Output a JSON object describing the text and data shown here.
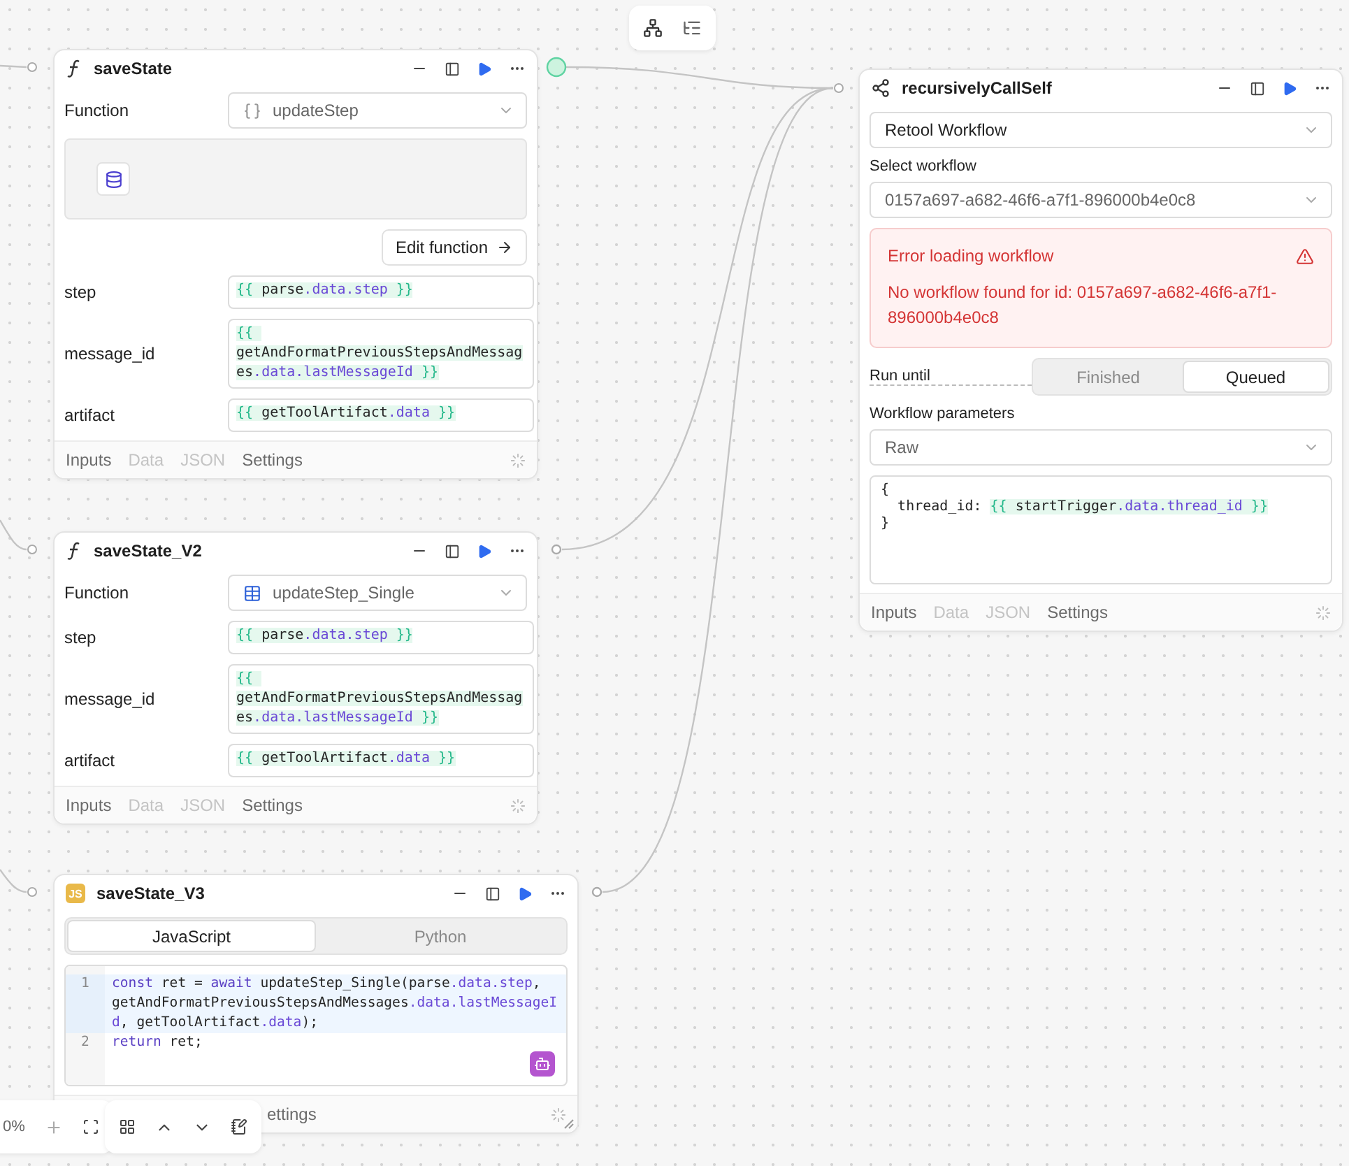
{
  "zoom": "0%",
  "nodes": [
    {
      "kind": "function",
      "title": "saveState",
      "output_active": true,
      "show_preview": true,
      "function_field": {
        "label": "Function",
        "value": "updateStep",
        "kind": "code"
      },
      "edit_button": "Edit function",
      "params": [
        {
          "name": "step",
          "tokens": [
            {
              "text": "{{ ",
              "kind": "brace"
            },
            {
              "text": "parse",
              "kind": "ident"
            },
            {
              "text": ".data.step",
              "kind": "prop"
            },
            {
              "text": " }}",
              "kind": "brace"
            }
          ]
        },
        {
          "name": "message_id",
          "tokens": [
            {
              "text": "{{ ",
              "kind": "brace"
            },
            {
              "text": "getAndFormatPreviousStepsAndMessages",
              "kind": "ident"
            },
            {
              "text": ".data.lastMessageId",
              "kind": "prop"
            },
            {
              "text": " }}",
              "kind": "brace"
            }
          ]
        },
        {
          "name": "artifact",
          "tokens": [
            {
              "text": "{{ ",
              "kind": "brace"
            },
            {
              "text": "getToolArtifact",
              "kind": "ident"
            },
            {
              "text": ".data",
              "kind": "prop"
            },
            {
              "text": " }}",
              "kind": "brace"
            }
          ]
        }
      ],
      "footer_tabs": [
        {
          "label": "Inputs",
          "disabled": false
        },
        {
          "label": "Data",
          "disabled": true
        },
        {
          "label": "JSON",
          "disabled": true
        },
        {
          "label": "Settings",
          "disabled": false
        }
      ]
    },
    {
      "kind": "function",
      "title": "saveState_V2",
      "output_active": false,
      "show_preview": false,
      "function_field": {
        "label": "Function",
        "value": "updateStep_Single",
        "kind": "table"
      },
      "params": [
        {
          "name": "step",
          "tokens": [
            {
              "text": "{{ ",
              "kind": "brace"
            },
            {
              "text": "parse",
              "kind": "ident"
            },
            {
              "text": ".data.step",
              "kind": "prop"
            },
            {
              "text": " }}",
              "kind": "brace"
            }
          ]
        },
        {
          "name": "message_id",
          "tokens": [
            {
              "text": "{{ ",
              "kind": "brace"
            },
            {
              "text": "getAndFormatPreviousStepsAndMessages",
              "kind": "ident"
            },
            {
              "text": ".data.lastMessageId",
              "kind": "prop"
            },
            {
              "text": " }}",
              "kind": "brace"
            }
          ]
        },
        {
          "name": "artifact",
          "tokens": [
            {
              "text": "{{ ",
              "kind": "brace"
            },
            {
              "text": "getToolArtifact",
              "kind": "ident"
            },
            {
              "text": ".data",
              "kind": "prop"
            },
            {
              "text": " }}",
              "kind": "brace"
            }
          ]
        }
      ],
      "footer_tabs": [
        {
          "label": "Inputs",
          "disabled": false
        },
        {
          "label": "Data",
          "disabled": true
        },
        {
          "label": "JSON",
          "disabled": true
        },
        {
          "label": "Settings",
          "disabled": false
        }
      ]
    },
    {
      "kind": "code",
      "title": "saveState_V3",
      "badge": "JS",
      "output_active": false,
      "languages": [
        {
          "label": "JavaScript",
          "selected": true
        },
        {
          "label": "Python",
          "selected": false
        }
      ],
      "code_lines": [
        {
          "number": "1",
          "active": true,
          "tokens": [
            {
              "text": "const",
              "kind": "kw"
            },
            {
              "text": " ret = ",
              "kind": "plain"
            },
            {
              "text": "await",
              "kind": "kw"
            },
            {
              "text": " updateStep_Single(parse",
              "kind": "plain"
            },
            {
              "text": ".data.step",
              "kind": "prop"
            },
            {
              "text": ", getAndFormatPreviousStepsAndMessages",
              "kind": "plain"
            },
            {
              "text": ".data.lastMessageId",
              "kind": "prop"
            },
            {
              "text": ", getToolArtifact",
              "kind": "plain"
            },
            {
              "text": ".data",
              "kind": "prop"
            },
            {
              "text": ");",
              "kind": "plain"
            }
          ]
        },
        {
          "number": "2",
          "active": false,
          "tokens": [
            {
              "text": "return",
              "kind": "kw"
            },
            {
              "text": " ret;",
              "kind": "plain"
            }
          ]
        }
      ],
      "footer_tabs": [
        {
          "label": "ettings",
          "disabled": false
        }
      ]
    },
    {
      "kind": "workflow",
      "title": "recursivelyCallSelf",
      "resource": "Retool Workflow",
      "select_label": "Select workflow",
      "workflow_id": "0157a697-a682-46f6-a7f1-896000b4e0c8",
      "error": {
        "title": "Error loading workflow",
        "message": "No workflow found for id: 0157a697-a682-46f6-a7f1-896000b4e0c8"
      },
      "run_until": {
        "label": "Run until",
        "options": [
          {
            "label": "Finished",
            "selected": false
          },
          {
            "label": "Queued",
            "selected": true
          }
        ]
      },
      "params_label": "Workflow parameters",
      "params_mode": "Raw",
      "params_lines": [
        [
          {
            "text": "{",
            "kind": "plain"
          }
        ],
        [
          {
            "text": "  thread_id: ",
            "kind": "plain"
          },
          {
            "text": "{{ ",
            "kind": "brace"
          },
          {
            "text": "startTrigger",
            "kind": "ident"
          },
          {
            "text": ".data.thread_id",
            "kind": "prop"
          },
          {
            "text": " }}",
            "kind": "brace"
          }
        ],
        [
          {
            "text": "}",
            "kind": "plain"
          }
        ]
      ],
      "footer_tabs": [
        {
          "label": "Inputs",
          "disabled": false
        },
        {
          "label": "Data",
          "disabled": true
        },
        {
          "label": "JSON",
          "disabled": true
        },
        {
          "label": "Settings",
          "disabled": false
        }
      ]
    }
  ]
}
